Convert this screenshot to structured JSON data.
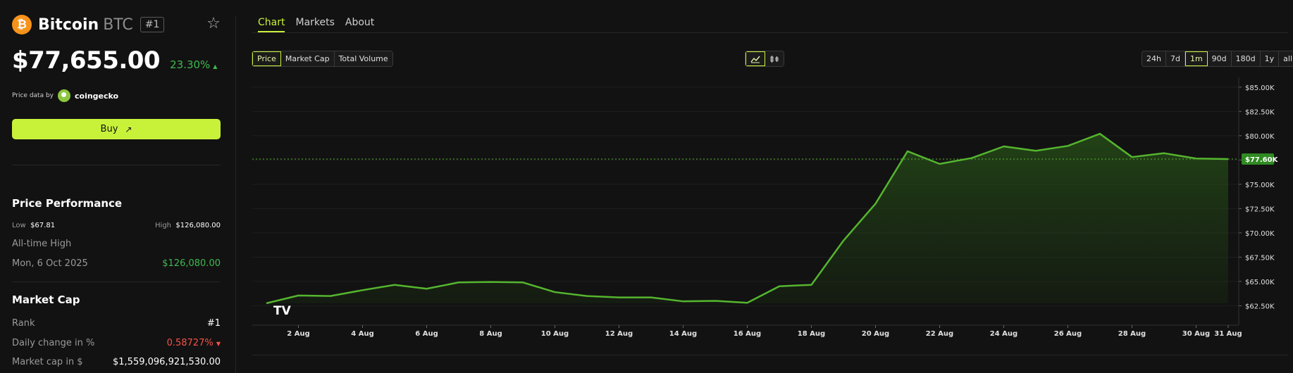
{
  "coin": {
    "logo_glyph": "₿",
    "name": "Bitcoin",
    "symbol": "BTC",
    "rank": "#1",
    "price": "$77,655.00",
    "change": "23.30%",
    "change_arrow": "▲",
    "price_data_label": "Price data by",
    "provider": "coingecko",
    "buy_label": "Buy",
    "buy_arrow": "↗",
    "star_glyph": "☆"
  },
  "performance": {
    "title": "Price Performance",
    "low_label": "Low",
    "low_value": "$67.81",
    "high_label": "High",
    "high_value": "$126,080.00",
    "ath_label": "All-time High",
    "ath_date": "Mon, 6 Oct 2025",
    "ath_value": "$126,080.00"
  },
  "market_cap": {
    "title": "Market Cap",
    "rank_label": "Rank",
    "rank_value": "#1",
    "daily_change_label": "Daily change in %",
    "daily_change_value": "0.58727%",
    "daily_change_arrow": "▼",
    "cap_label": "Market cap in $",
    "cap_value": "$1,559,096,921,530.00"
  },
  "tabs": [
    "Chart",
    "Markets",
    "About"
  ],
  "metric_options": [
    "Price",
    "Market Cap",
    "Total Volume"
  ],
  "chart_type_icons": [
    "line-chart-icon",
    "candlestick-chart-icon"
  ],
  "range_options": [
    "24h",
    "7d",
    "1m",
    "90d",
    "180d",
    "1y",
    "all"
  ],
  "active_range": "1m",
  "colors": {
    "accent": "#c8f23a",
    "up": "#3fb950",
    "down": "#f85149",
    "line": "#55b52f",
    "btc": "#f7931a"
  },
  "chart_data": {
    "type": "area",
    "x": [
      "1 Aug",
      "2 Aug",
      "3 Aug",
      "4 Aug",
      "5 Aug",
      "6 Aug",
      "7 Aug",
      "8 Aug",
      "9 Aug",
      "10 Aug",
      "11 Aug",
      "12 Aug",
      "13 Aug",
      "14 Aug",
      "15 Aug",
      "16 Aug",
      "17 Aug",
      "18 Aug",
      "19 Aug",
      "20 Aug",
      "21 Aug",
      "22 Aug",
      "23 Aug",
      "24 Aug",
      "25 Aug",
      "26 Aug",
      "27 Aug",
      "28 Aug",
      "29 Aug",
      "30 Aug",
      "31 Aug"
    ],
    "values": [
      62750,
      63550,
      63500,
      64100,
      64650,
      64250,
      64900,
      64950,
      64900,
      63900,
      63500,
      63350,
      63350,
      62950,
      63000,
      62800,
      64500,
      64650,
      69200,
      73000,
      78400,
      77100,
      77700,
      78900,
      78450,
      78950,
      80200,
      77800,
      78200,
      77650,
      77600
    ],
    "x_tick_labels": [
      "2 Aug",
      "4 Aug",
      "6 Aug",
      "8 Aug",
      "10 Aug",
      "12 Aug",
      "14 Aug",
      "16 Aug",
      "18 Aug",
      "20 Aug",
      "22 Aug",
      "24 Aug",
      "26 Aug",
      "28 Aug",
      "30 Aug",
      "31 Aug"
    ],
    "y_tick_labels": [
      "$85.00K",
      "$82.50K",
      "$80.00K",
      "$77.50K",
      "$75.00K",
      "$72.50K",
      "$70.00K",
      "$67.50K",
      "$65.00K",
      "$62.50K"
    ],
    "y_ticks": [
      85000,
      82500,
      80000,
      77500,
      75000,
      72500,
      70000,
      67500,
      65000,
      62500
    ],
    "ylim": [
      60500,
      86000
    ],
    "current_value": 77600,
    "current_label": "$77.60K",
    "watermark": "TV",
    "grid": true,
    "title": "",
    "xlabel": "",
    "ylabel": ""
  }
}
